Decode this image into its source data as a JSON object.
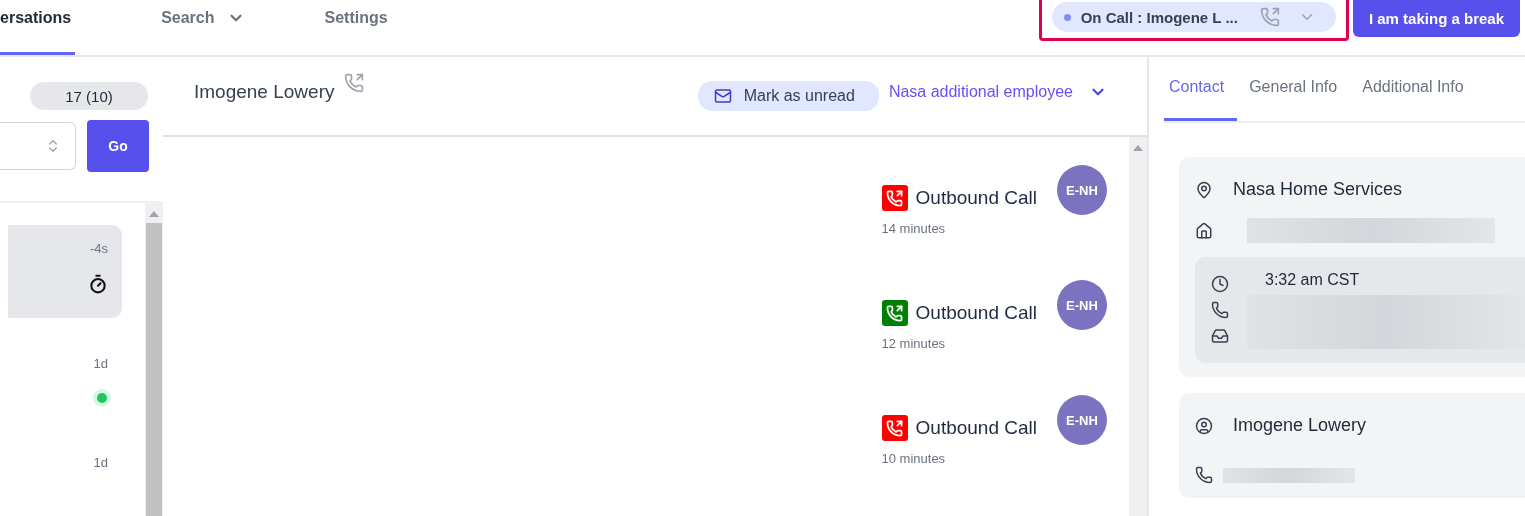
{
  "nav": {
    "tabs": [
      {
        "label": "ersations",
        "selected": true,
        "dropdown": false
      },
      {
        "label": "Search",
        "selected": false,
        "dropdown": true
      },
      {
        "label": "Settings",
        "selected": false,
        "dropdown": false
      }
    ],
    "on_call": "On Call : Imogene L ...",
    "break_button": "I am taking a break"
  },
  "sidebar": {
    "counter": "17 (10)",
    "go_button": "Go",
    "items": [
      {
        "time": "-4s",
        "kind": "timer",
        "selected": true
      },
      {
        "time": "1d",
        "kind": "online",
        "selected": false
      },
      {
        "time": "1d",
        "kind": "plain",
        "selected": false
      }
    ]
  },
  "conversation": {
    "name": "Imogene Lowery",
    "mark_unread": "Mark as unread",
    "assignee": "Nasa additional employee",
    "messages": [
      {
        "title": "Outbound Call",
        "time": "14 minutes",
        "avatar": "E-NH",
        "color": "#ff0000"
      },
      {
        "title": "Outbound Call",
        "time": "12 minutes",
        "avatar": "E-NH",
        "color": "#008000"
      },
      {
        "title": "Outbound Call",
        "time": "10 minutes",
        "avatar": "E-NH",
        "color": "#ff0000"
      }
    ]
  },
  "details": {
    "tabs": [
      {
        "label": "Contact",
        "selected": true
      },
      {
        "label": "General Info",
        "selected": false
      },
      {
        "label": "Additional Info",
        "selected": false
      }
    ],
    "company": "Nasa Home Services",
    "local_time": "3:32 am CST",
    "contact_name": "Imogene Lowery"
  }
}
